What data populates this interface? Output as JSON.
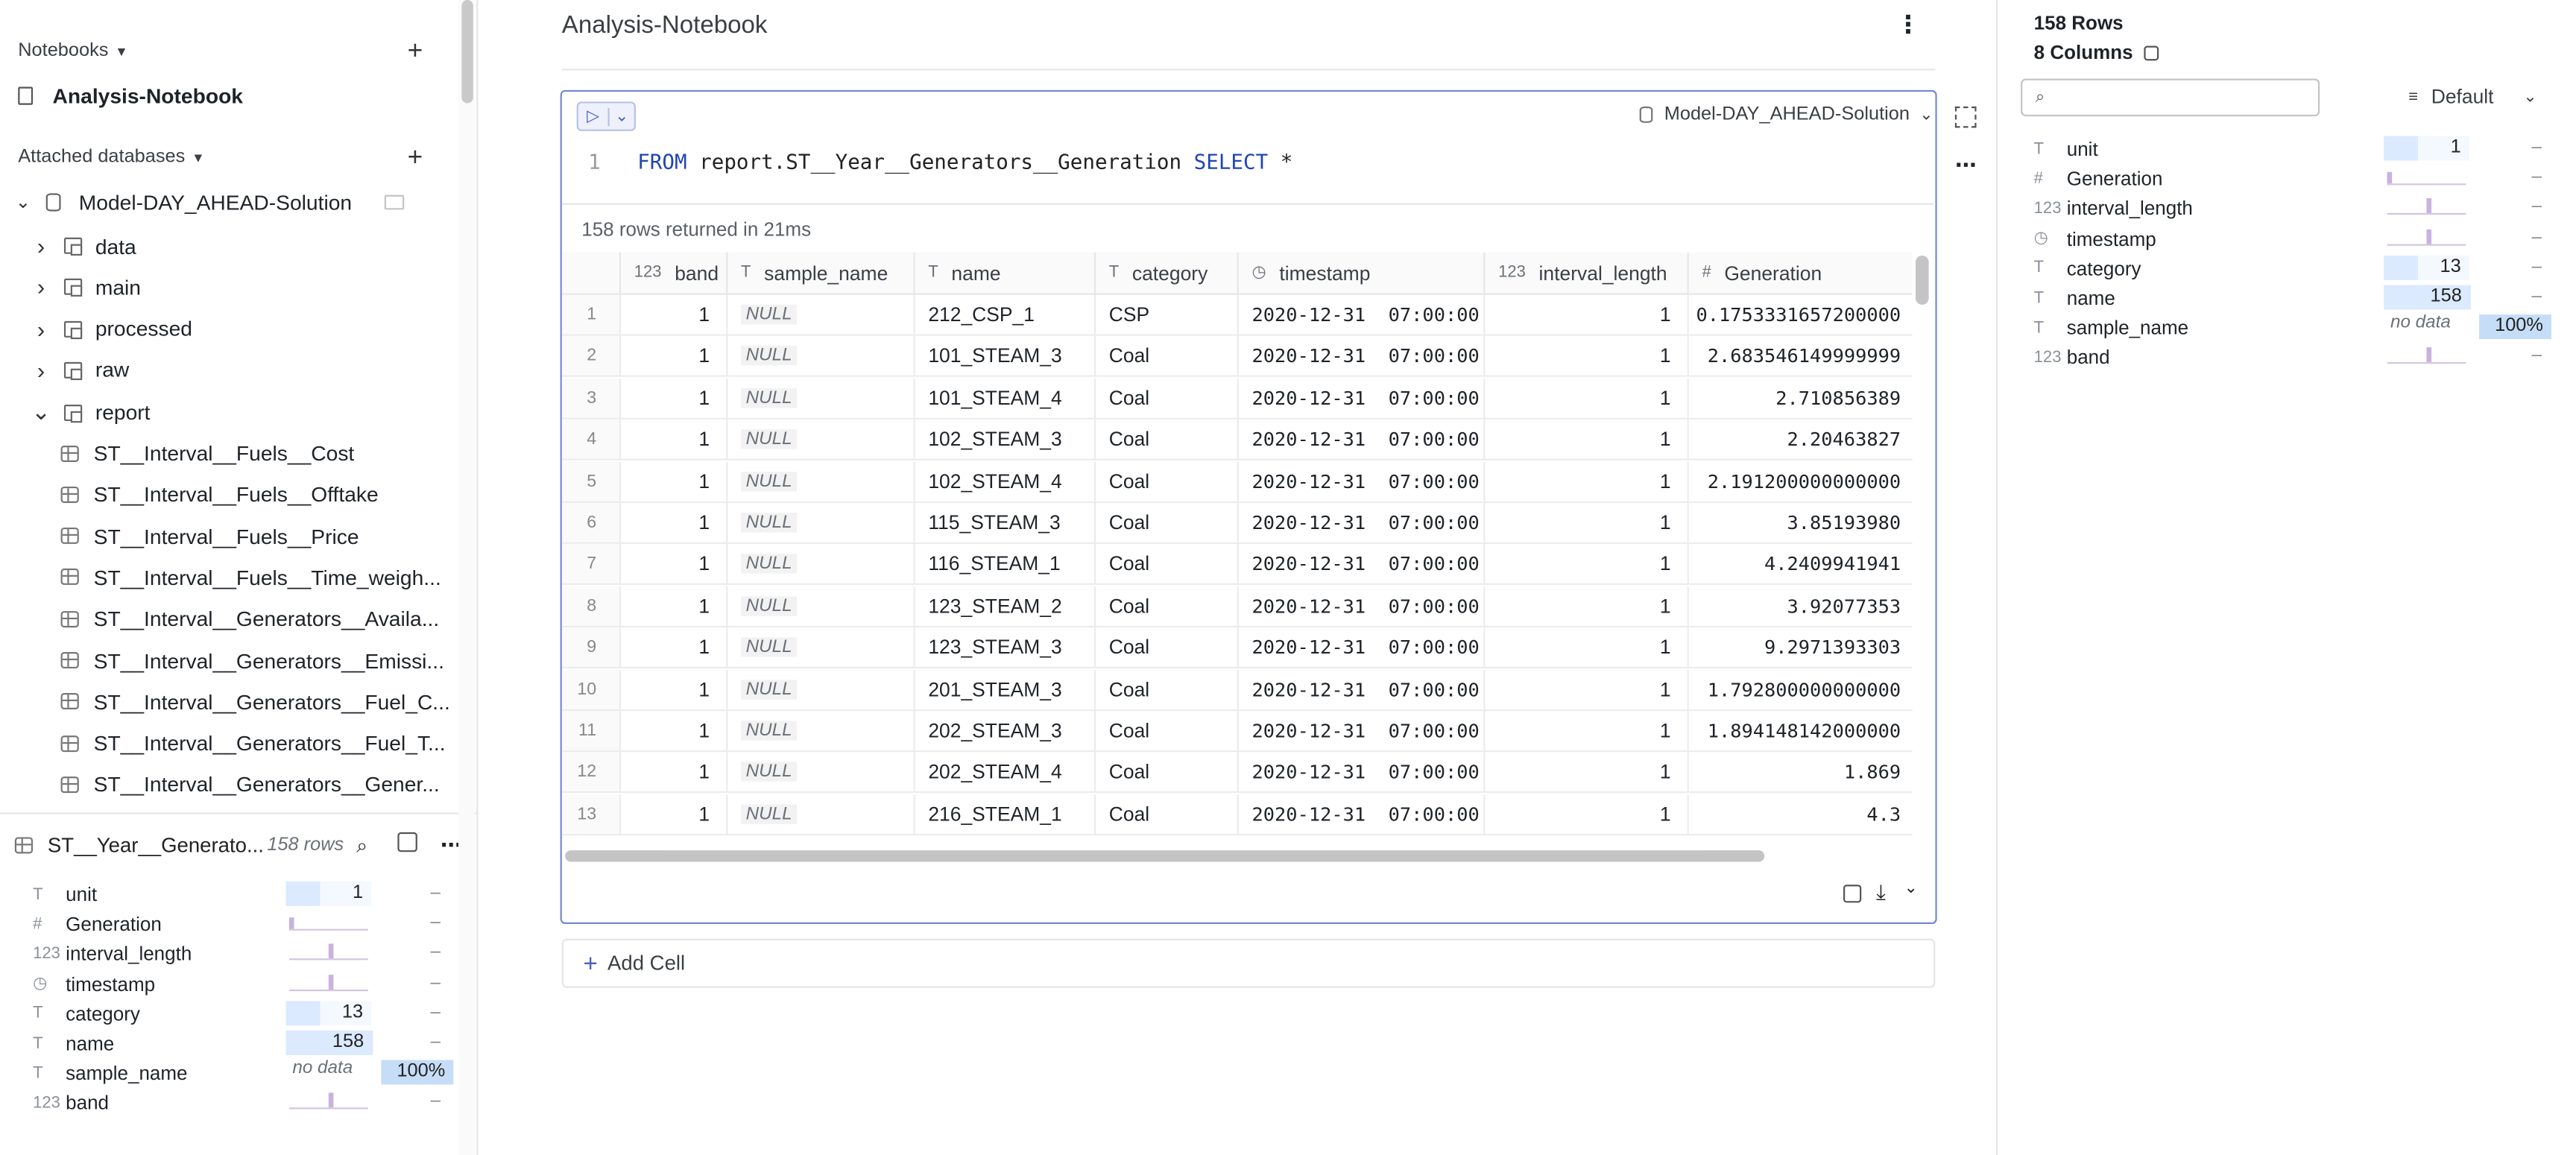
{
  "sidebar": {
    "notebooks_label": "Notebooks",
    "notebook_name": "Analysis-Notebook",
    "attached_label": "Attached databases",
    "database": "Model-DAY_AHEAD-Solution",
    "schemas": [
      "data",
      "main",
      "processed",
      "raw",
      "report"
    ],
    "tables": [
      "ST__Interval__Fuels__Cost",
      "ST__Interval__Fuels__Offtake",
      "ST__Interval__Fuels__Price",
      "ST__Interval__Fuels__Time_weigh...",
      "ST__Interval__Generators__Availa...",
      "ST__Interval__Generators__Emissi...",
      "ST__Interval__Generators__Fuel_C...",
      "ST__Interval__Generators__Fuel_T...",
      "ST__Interval__Generators__Gener..."
    ]
  },
  "inspector": {
    "table_name": "ST__Year__Generato...",
    "row_count": "158 rows",
    "columns": [
      {
        "type": "T",
        "name": "unit",
        "value": "1",
        "fill": 0.22
      },
      {
        "type": "#",
        "name": "Generation",
        "value": ""
      },
      {
        "type": "123",
        "name": "interval_length",
        "value": ""
      },
      {
        "type": "clock",
        "name": "timestamp",
        "value": ""
      },
      {
        "type": "T",
        "name": "category",
        "value": "13",
        "fill": 0.08
      },
      {
        "type": "T",
        "name": "name",
        "value": "158",
        "fill": 1.0
      },
      {
        "type": "T",
        "name": "sample_name",
        "value": "no data"
      },
      {
        "type": "123",
        "name": "band",
        "value": ""
      }
    ],
    "pct": "100%",
    "dash": "–"
  },
  "main": {
    "title": "Analysis-Notebook",
    "db_select": "Model-DAY_AHEAD-Solution",
    "query": {
      "line": "1",
      "kw1": "FROM",
      "tbl": "report.ST__Year__Generators__Generation",
      "kw2": "SELECT",
      "star": "*"
    },
    "result_info": "158 rows returned in 21ms",
    "add_cell": "Add Cell",
    "headers": [
      {
        "icon": "123",
        "label": "band"
      },
      {
        "icon": "T",
        "label": "sample_name"
      },
      {
        "icon": "T",
        "label": "name"
      },
      {
        "icon": "T",
        "label": "category"
      },
      {
        "icon": "clock",
        "label": "timestamp"
      },
      {
        "icon": "123",
        "label": "interval_length"
      },
      {
        "icon": "#",
        "label": "Generation"
      }
    ],
    "rows": [
      [
        "1",
        "1",
        "NULL",
        "212_CSP_1",
        "CSP",
        "2020-12-31  07:00:00",
        "1",
        "0.1753331657200000"
      ],
      [
        "2",
        "1",
        "NULL",
        "101_STEAM_3",
        "Coal",
        "2020-12-31  07:00:00",
        "1",
        "2.683546149999999"
      ],
      [
        "3",
        "1",
        "NULL",
        "101_STEAM_4",
        "Coal",
        "2020-12-31  07:00:00",
        "1",
        "2.710856389"
      ],
      [
        "4",
        "1",
        "NULL",
        "102_STEAM_3",
        "Coal",
        "2020-12-31  07:00:00",
        "1",
        "2.20463827"
      ],
      [
        "5",
        "1",
        "NULL",
        "102_STEAM_4",
        "Coal",
        "2020-12-31  07:00:00",
        "1",
        "2.191200000000000"
      ],
      [
        "6",
        "1",
        "NULL",
        "115_STEAM_3",
        "Coal",
        "2020-12-31  07:00:00",
        "1",
        "3.85193980"
      ],
      [
        "7",
        "1",
        "NULL",
        "116_STEAM_1",
        "Coal",
        "2020-12-31  07:00:00",
        "1",
        "4.2409941941"
      ],
      [
        "8",
        "1",
        "NULL",
        "123_STEAM_2",
        "Coal",
        "2020-12-31  07:00:00",
        "1",
        "3.92077353"
      ],
      [
        "9",
        "1",
        "NULL",
        "123_STEAM_3",
        "Coal",
        "2020-12-31  07:00:00",
        "1",
        "9.2971393303"
      ],
      [
        "10",
        "1",
        "NULL",
        "201_STEAM_3",
        "Coal",
        "2020-12-31  07:00:00",
        "1",
        "1.792800000000000"
      ],
      [
        "11",
        "1",
        "NULL",
        "202_STEAM_3",
        "Coal",
        "2020-12-31  07:00:00",
        "1",
        "1.894148142000000"
      ],
      [
        "12",
        "1",
        "NULL",
        "202_STEAM_4",
        "Coal",
        "2020-12-31  07:00:00",
        "1",
        "1.869"
      ],
      [
        "13",
        "1",
        "NULL",
        "216_STEAM_1",
        "Coal",
        "2020-12-31  07:00:00",
        "1",
        "4.3"
      ]
    ]
  },
  "right": {
    "rows_label": "158 Rows",
    "cols_label": "8 Columns",
    "search_placeholder": "",
    "sort_label": "Default"
  },
  "colors": {
    "accent": "#7389d6",
    "bar": "#dbeafe",
    "hist": "#c9b2de"
  }
}
